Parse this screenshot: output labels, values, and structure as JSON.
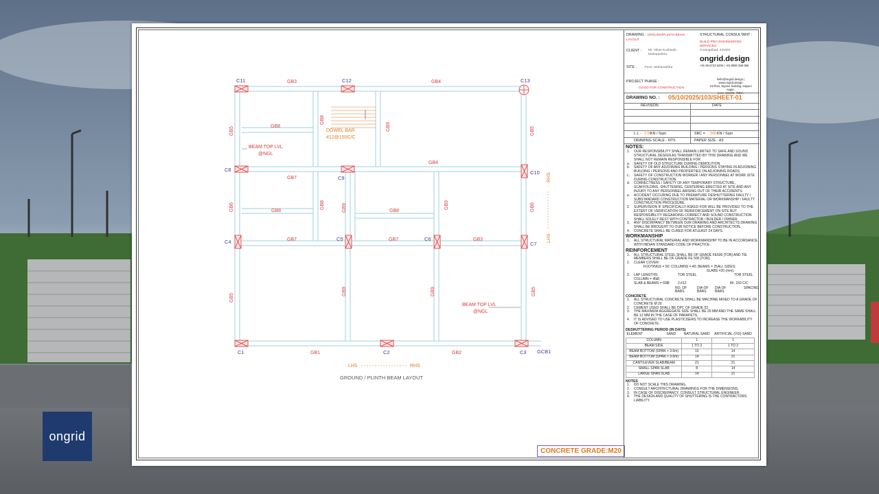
{
  "brand": {
    "logo_text": "ongrid"
  },
  "plan": {
    "title": "GROUND / PLINTH BEAM LAYOUT",
    "columns": {
      "c1": "C1",
      "c2": "C2",
      "c3": "C3",
      "c4": "C4",
      "c5": "C5",
      "c6": "C6",
      "c7": "C7",
      "c8": "C8",
      "c9": "C9",
      "c10": "C10",
      "c11": "C11",
      "c12": "C12",
      "c13": "C13"
    },
    "beams": {
      "gb3": "GB3",
      "gb4_top": "GB4",
      "gb8_a": "GB8",
      "gb8_v": "GB8",
      "gb9_top": "GB9",
      "gb5_left_top": "GB5",
      "gb5_right_top": "GB5",
      "gb4_mid": "GB4",
      "gb7_left": "GB7",
      "gb8_b": "GB8",
      "gb8_v2": "GB8",
      "gb9_mid": "GB9",
      "gb8_c": "GB8",
      "gb9_right": "GB9",
      "gb6_left": "GB6",
      "gb6_right": "GB6",
      "gb7_bl": "GB7",
      "gb7_bm": "GB7",
      "gb3_br": "GB3",
      "gb5_left_bot": "GB5",
      "gb9_bot_a": "GB9",
      "gb9_bot_b": "GB9",
      "gb5_right_bot": "GB5",
      "gb1": "GB1",
      "gb2": "GB2",
      "gcb1": "GCB1"
    },
    "dowel_line1": "DOWEL BAR",
    "dowel_line2": "#12@150C/C",
    "beam_top_1a": "BEAM TOP LVL",
    "beam_top_1b": "@NGL",
    "beam_top_2a": "BEAM TOP LVL",
    "beam_top_2b": "@NGL",
    "rhs_top": "RHS",
    "lhs_right": "LHS",
    "lhs_bottom": "LHS",
    "rhs_bottom": "RHS"
  },
  "title_block": {
    "drawing_label": "DRAWING :",
    "drawing_value": "GROUND/PLINTH BEAM LAYOUT",
    "consultant_label": "STRUCTURAL CONSULTANT :",
    "consultant_name1": "BUILD PRO ENGINEERING",
    "consultant_name2": "SERVICES",
    "consultant_city": "Aurangabad, 431001",
    "client_label": "CLIENT :",
    "client_name": "Mr. Vikas Kushwah,",
    "client_state": "Maharashtra,",
    "site_label": "SITE :",
    "site_value": "Pune, Maharashtra",
    "ongrid_brand": "ongrid.design",
    "contact1": "+91 99 8723 5209  |  +91 8080 388 085",
    "contact2": "hello@ongrid.design |",
    "contact3": "www.ongrid.design",
    "contact4": "1st floor, skyone building, kalyani nagar,",
    "contact5": "pune 411006, INDIA",
    "phase_label": "PROJECT PHASE :",
    "phase_value": "GOOD FOR CONSTRUCTION",
    "drawing_no_label": "DRAWING NO. :",
    "drawing_no": "05/10/2025/103/SHEET-01",
    "revision": "REVISION",
    "date": "DATE",
    "ll_label": "L.L - ",
    "ll_value": "2.00",
    "ll_unit": " KN / Sqm",
    "sbc_label": "SBC = ",
    "sbc_value": "200",
    "sbc_unit": "  KN / Sqm",
    "scale": "DRAWING SCALE - NTS",
    "paper": "PAPER SIZE - A3"
  },
  "notes": {
    "heading": "NOTES:",
    "items": [
      {
        "n": "1.",
        "t": "OUR RESPONSIBILITY SHALL REMAIN LIMITED TO SAFE AND SOUND STRUCTURAL DESIGN AS TRANSMITTED BY THIS DRAWING AND WE SHALL NOT REMAIN RESPONSIBLE FOR"
      },
      {
        "n": "a.",
        "t": "SAFETY OF OLD STRUCTURE DURING DEMOLITION."
      },
      {
        "n": "b.",
        "t": "SAFETY OF ANY ADJOINING BUILDING / PERSONS STAYING IN ADJOINING BUILDING / PERSONS AND PROPERTIES ON ADJOINING ROADS."
      },
      {
        "n": "c.",
        "t": "SAFETY OF CONSTRUCTION WORKER / ANY PERSONNEL AT WORK SITE DURING CONSTRUCTION."
      },
      {
        "n": "d.",
        "t": "CORRECTNESS / SAFETY OF ANY TEMPORARY STRUCTURE, SCAFFOLDING, SHUTTERING, CENTERING ERECTED AT SITE AND ANY INJURY TO ANY PERSONNEL ARISING OUT OF THEIR ACCIDENTS."
      },
      {
        "n": "e.",
        "t": "ACCIDENT OCCURING DUE TO PREMATURE DESHUTTERING FAULTY / SUBSTANDARD CONSTRUCTION MATERIAL OR WORKMANSHIP / FAULTY CONSTRUCTION PROCEDURE."
      },
      {
        "n": "2.",
        "t": "SUPERVISION IF SPECIFICALLY ASKED FOR WILL BE PROVIDED TO THE EXTENT OF VERIFICATION OF REINFORCEMENT ON SITE BUT RESPONSIBILITY REGARDING CORRECT AND SOUND CONSTRUCTION SHALL SOLELY REST WITH CONTRACTOR / BUILDER / OWNER."
      },
      {
        "n": "3.",
        "t": "ANY DISCRIPANCY BETWEEN OUR DRAWING AND ARCHITECTS DRAWING SHALL BE BROUGHT TO OUR NOTICE BEFORE CONSTRUCTION."
      },
      {
        "n": "4.",
        "t": "CONCRETE SHALL BE CURED FOR ATLEAST 24 DAYS."
      }
    ]
  },
  "workmanship": {
    "heading": "WORKMANSHIP",
    "items": [
      {
        "n": "1.",
        "t": "ALL STRUCTURAL MATERIAL AND WORKMANSHIP TO BE IN ACCORDANCE WITH INDIAN STANDARD CODE OF PRACTICE."
      }
    ]
  },
  "reinforcement": {
    "heading": "REINFORCEMENT",
    "items": [
      {
        "n": "1.",
        "t": "ALL STRUCTURAL STEEL SHALL BE OF GRADE FE500 [TOR] AND TIE MEMBERS SHALL BE OF GRADE FE 500 [TOR]."
      },
      {
        "n": "2.",
        "t": "CLEAR COVER:"
      }
    ],
    "cover1": "FOOTINGS = 50; COLUMNS = 40; BEAMS = 25ALL SIDES;",
    "cover2": "SLABS =20 (mm).",
    "lap_n": "3.",
    "lap": "LAP LENGTHS:",
    "tor1": "TOR STEEL",
    "tor2": "TOR STEEL",
    "col": "COLUMN = 45Ø,",
    "slab": "SLAB & BEAMS = 60Ø",
    "bars": "2,#12",
    "spacing_val": "8#, 150 C/C",
    "no_of": "NO. OF",
    "bars_lbl": "BARS",
    "dia_of1": "DIA OF",
    "bars_lbl2": "BARS",
    "dia_of2": "DIA OF",
    "bars_lbl3": "BARS",
    "spacing": "SPACING"
  },
  "concrete": {
    "heading": "CONCRETE",
    "items": [
      {
        "n": "1.",
        "t": "ALL STRUCTURAL CONCRETE SHALL BE MACHINE MIXED TO A GRADE OF CONCRETE M   20"
      },
      {
        "n": "2.",
        "t": "CEMENT USED SHALL BE OPC OF GRADE        53"
      },
      {
        "n": "3.",
        "t": "THE MAXIMUM AGGREGATE SIZE SHALL BE 20 MM AND THE SAME SHALL BE 12 MM IN THE CASE OF PARAPETS."
      },
      {
        "n": "4.",
        "t": "IT IS ADVISED TO USE PLASTICISERS TO INCREASE THE WORKABILITY OF CONCRETE."
      }
    ]
  },
  "deshuttering": {
    "heading": "DESHUTTERING PERIOD (IN DAYS)",
    "col_element": "ELEMENT",
    "col_sand": "SAND",
    "col_natural": "NATURAL SAND",
    "col_artificial": "ARTIFICIAL (VSI) SAND",
    "rows": [
      {
        "e": "COLUMN",
        "a": "1",
        "b": "1"
      },
      {
        "e": "BEAM SIDE",
        "a": "1 TO 2",
        "b": "1 TO 2"
      },
      {
        "e": "BEAM BOTTOM (SPAN < 3.6m)",
        "a": "10",
        "b": "14"
      },
      {
        "e": "BEAM BOTTOM (SPAN > 3.6m)",
        "a": "14",
        "b": "21"
      },
      {
        "e": "CANTILEVER SLAB/BEAM",
        "a": "21",
        "b": "21"
      },
      {
        "e": "SMALL SPAN SLAB",
        "a": "8",
        "b": "14"
      },
      {
        "e": "LARGE SPAN SLAB",
        "a": "14",
        "b": "21"
      }
    ]
  },
  "notes2": {
    "heading": "NOTES",
    "items": [
      {
        "n": "1.",
        "t": "DO NOT SCALE THIS DRAWING."
      },
      {
        "n": "2.",
        "t": "CONSULT ARCHITECTURAL DRAWINGS FOR THE DIMENSIONS."
      },
      {
        "n": "3.",
        "t": "IN CASE OF DISCREPANCY, CONSULT STRUCTURAL ENGINEER."
      },
      {
        "n": "4.",
        "t": "THE DESIGN AND QUALITY OF SHUTTERING IS THE CONTRACTORS LIABILITY."
      }
    ]
  },
  "grade_box": "CONCRETE GRADE:M20",
  "colors": {
    "beam": "#9ecfe3",
    "column": "#e05050",
    "label_red": "#d83a3a",
    "label_blue": "#3b3b9a",
    "accent_orange": "#e07a1f",
    "brand_navy": "#1f3a6e"
  }
}
